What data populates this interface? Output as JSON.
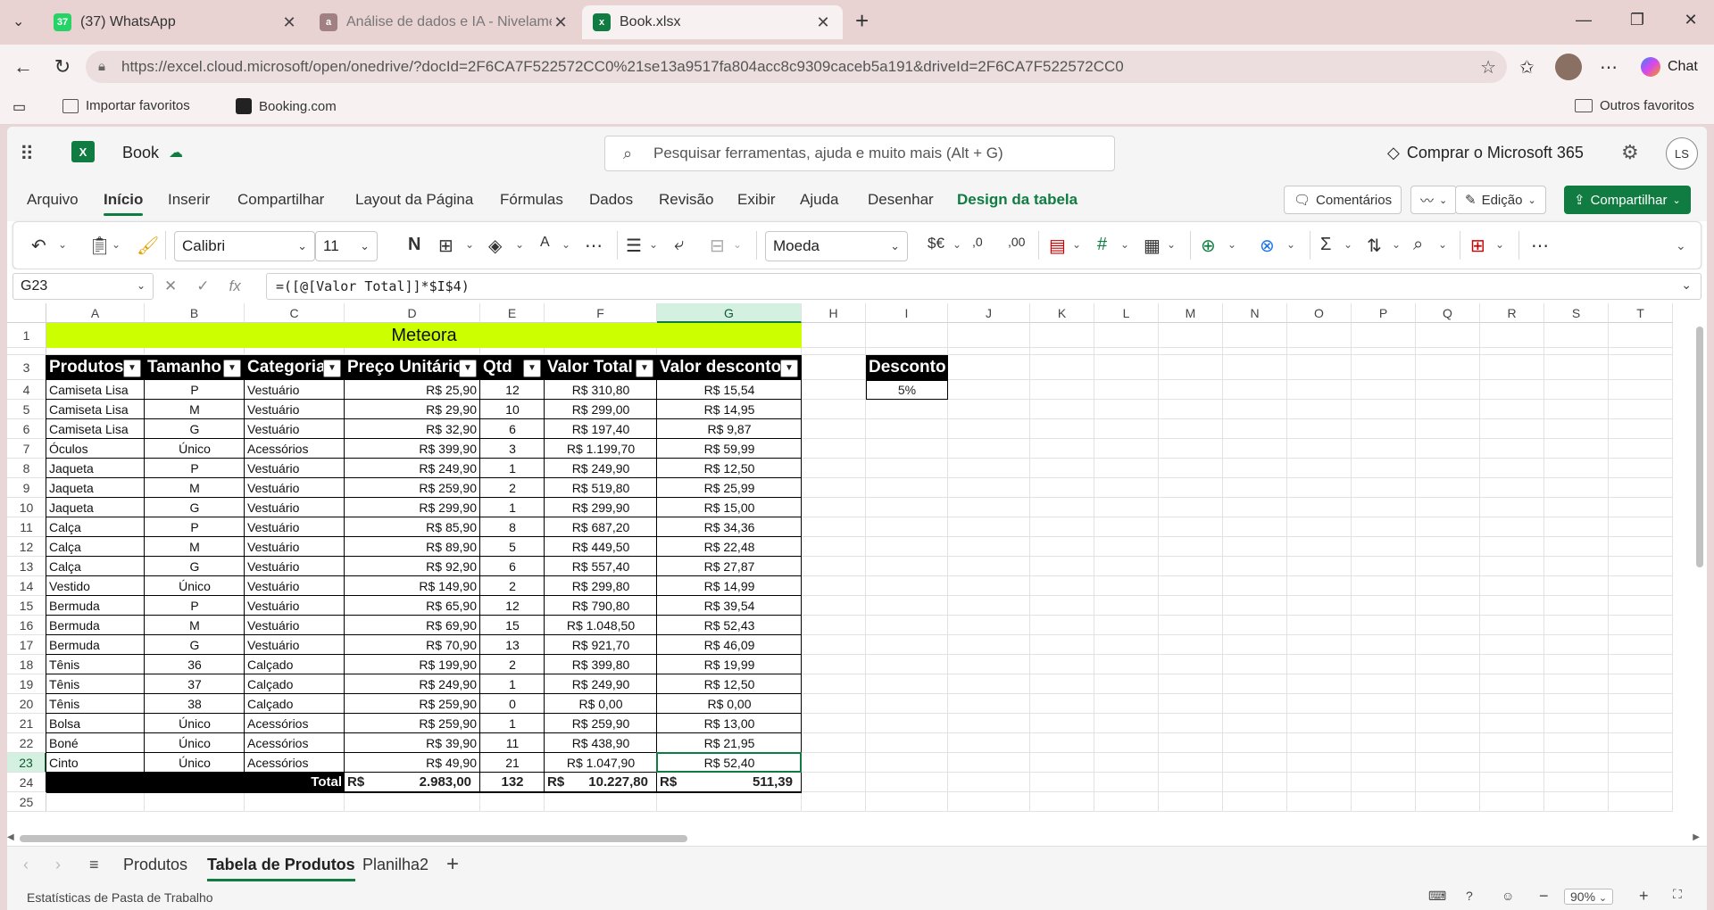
{
  "browser": {
    "tabs": [
      {
        "label": "(37) WhatsApp",
        "badge": "37",
        "icon": "whatsapp-icon"
      },
      {
        "label": "Análise de dados e IA - Nivelamen",
        "icon": "a-icon"
      },
      {
        "label": "Book.xlsx",
        "icon": "excel-icon",
        "active": true
      }
    ],
    "url": "https://excel.cloud.microsoft/open/onedrive/?docId=2F6CA7F522572CC0%21se13a9517fa804acc8c9309caceb5a191&driveId=2F6CA7F522572CC0",
    "chat_label": "Chat",
    "bookmarks": {
      "import": "Importar favoritos",
      "booking": "Booking.com",
      "other": "Outros favoritos"
    }
  },
  "app": {
    "doc_name": "Book",
    "search_placeholder": "Pesquisar ferramentas, ajuda e muito mais (Alt + G)",
    "buy_label": "Comprar o Microsoft 365",
    "user_initials": "LS",
    "ribbon_tabs": [
      "Arquivo",
      "Início",
      "Inserir",
      "Compartilhar",
      "Layout da Página",
      "Fórmulas",
      "Dados",
      "Revisão",
      "Exibir",
      "Ajuda",
      "Desenhar",
      "Design da tabela"
    ],
    "active_tab": "Início",
    "comments_label": "Comentários",
    "edit_label": "Edição",
    "share_label": "Compartilhar",
    "font_name": "Calibri",
    "font_size": "11",
    "number_format": "Moeda",
    "accent_color": "#107c41"
  },
  "formula_bar": {
    "name_box": "G23",
    "formula": "=([@[Valor Total]]*$I$4)"
  },
  "grid": {
    "columns": [
      "A",
      "B",
      "C",
      "D",
      "E",
      "F",
      "G",
      "H",
      "I",
      "J",
      "K",
      "L",
      "M",
      "N",
      "O",
      "P",
      "Q",
      "R",
      "S",
      "T"
    ],
    "rows": [
      "1",
      "2",
      "3",
      "4",
      "5",
      "6",
      "7",
      "8",
      "9",
      "10",
      "11",
      "12",
      "13",
      "14",
      "15",
      "16",
      "17",
      "18",
      "19",
      "20",
      "21",
      "22",
      "23",
      "24",
      "25"
    ],
    "selected_column": "G",
    "selected_row": "23",
    "title": "Meteora",
    "title_color": "#ccff00",
    "headers": [
      "Produtos",
      "Tamanho",
      "Categoria",
      "Preço Unitário",
      "Qtd",
      "Valor Total",
      "Valor desconto"
    ],
    "data": [
      [
        "Camiseta Lisa",
        "P",
        "Vestuário",
        "R$ 25,90",
        "12",
        "R$ 310,80",
        "R$ 15,54"
      ],
      [
        "Camiseta Lisa",
        "M",
        "Vestuário",
        "R$ 29,90",
        "10",
        "R$ 299,00",
        "R$ 14,95"
      ],
      [
        "Camiseta Lisa",
        "G",
        "Vestuário",
        "R$ 32,90",
        "6",
        "R$ 197,40",
        "R$ 9,87"
      ],
      [
        "Óculos",
        "Único",
        "Acessórios",
        "R$ 399,90",
        "3",
        "R$ 1.199,70",
        "R$ 59,99"
      ],
      [
        "Jaqueta",
        "P",
        "Vestuário",
        "R$ 249,90",
        "1",
        "R$ 249,90",
        "R$ 12,50"
      ],
      [
        "Jaqueta",
        "M",
        "Vestuário",
        "R$ 259,90",
        "2",
        "R$ 519,80",
        "R$ 25,99"
      ],
      [
        "Jaqueta",
        "G",
        "Vestuário",
        "R$ 299,90",
        "1",
        "R$ 299,90",
        "R$ 15,00"
      ],
      [
        "Calça",
        "P",
        "Vestuário",
        "R$ 85,90",
        "8",
        "R$ 687,20",
        "R$ 34,36"
      ],
      [
        "Calça",
        "M",
        "Vestuário",
        "R$ 89,90",
        "5",
        "R$ 449,50",
        "R$ 22,48"
      ],
      [
        "Calça",
        "G",
        "Vestuário",
        "R$ 92,90",
        "6",
        "R$ 557,40",
        "R$ 27,87"
      ],
      [
        "Vestido",
        "Único",
        "Vestuário",
        "R$ 149,90",
        "2",
        "R$ 299,80",
        "R$ 14,99"
      ],
      [
        "Bermuda",
        "P",
        "Vestuário",
        "R$ 65,90",
        "12",
        "R$ 790,80",
        "R$ 39,54"
      ],
      [
        "Bermuda",
        "M",
        "Vestuário",
        "R$ 69,90",
        "15",
        "R$ 1.048,50",
        "R$ 52,43"
      ],
      [
        "Bermuda",
        "G",
        "Vestuário",
        "R$ 70,90",
        "13",
        "R$ 921,70",
        "R$ 46,09"
      ],
      [
        "Tênis",
        "36",
        "Calçado",
        "R$ 199,90",
        "2",
        "R$ 399,80",
        "R$ 19,99"
      ],
      [
        "Tênis",
        "37",
        "Calçado",
        "R$ 249,90",
        "1",
        "R$ 249,90",
        "R$ 12,50"
      ],
      [
        "Tênis",
        "38",
        "Calçado",
        "R$ 259,90",
        "0",
        "R$ 0,00",
        "R$ 0,00"
      ],
      [
        "Bolsa",
        "Único",
        "Acessórios",
        "R$ 259,90",
        "1",
        "R$ 259,90",
        "R$ 13,00"
      ],
      [
        "Boné",
        "Único",
        "Acessórios",
        "R$ 39,90",
        "11",
        "R$ 438,90",
        "R$ 21,95"
      ],
      [
        "Cinto",
        "Único",
        "Acessórios",
        "R$ 49,90",
        "21",
        "R$ 1.047,90",
        "R$ 52,40"
      ]
    ],
    "total": {
      "label": "Total",
      "currency": "R$",
      "preco": "2.983,00",
      "qtd": "132",
      "valor_total": "10.227,80",
      "valor_desconto": "511,39"
    },
    "discount": {
      "header": "Desconto",
      "value": "5%"
    }
  },
  "sheets": {
    "tabs": [
      "Produtos",
      "Tabela de Produtos",
      "Planilha2"
    ],
    "active": "Tabela de Produtos"
  },
  "status": {
    "stats_label": "Estatísticas de Pasta de Trabalho",
    "zoom": "90%"
  }
}
